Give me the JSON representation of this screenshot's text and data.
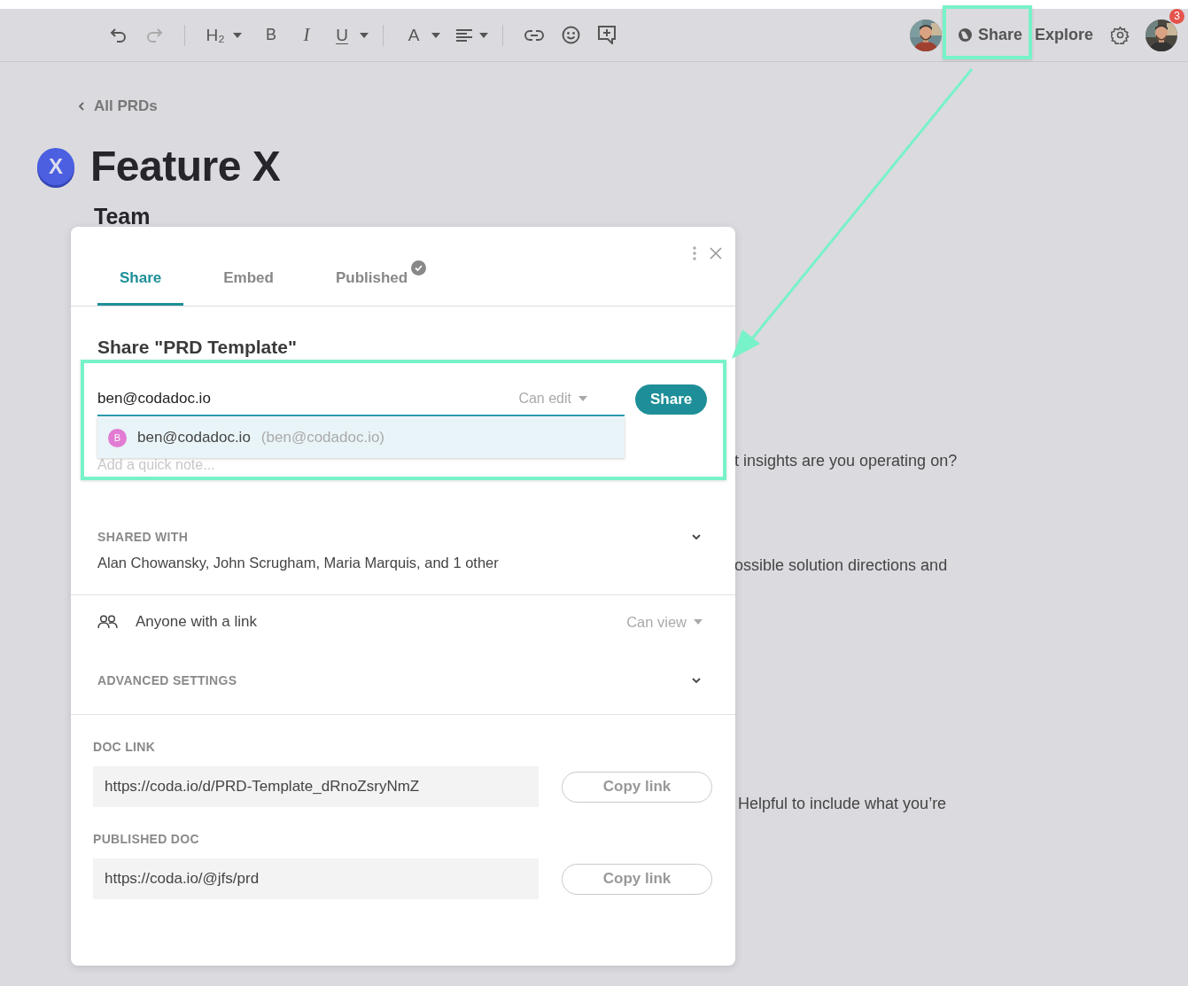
{
  "toolbar": {
    "undo": {
      "disabled": false
    },
    "redo": {
      "disabled": true
    },
    "heading_label": "H₂",
    "bold_label": "B",
    "italic_label": "I",
    "underline_label": "U",
    "color_label": "A"
  },
  "header": {
    "share_label": "Share",
    "explore_label": "Explore",
    "notification_count": "3"
  },
  "doc": {
    "back_label": "All PRDs",
    "badge_letter": "X",
    "title": "Feature X",
    "section_heading": "Team",
    "body_fragments": [
      "t insights are you operating on?",
      "ossible solution directions and",
      "Helpful to include what you’re"
    ]
  },
  "dialog": {
    "tabs": [
      {
        "label": "Share",
        "selected": true,
        "verified": false
      },
      {
        "label": "Embed",
        "selected": false,
        "verified": false
      },
      {
        "label": "Published",
        "selected": false,
        "verified": true
      }
    ],
    "heading": "Share \"PRD Template\"",
    "invite": {
      "value": "ben@codadoc.io",
      "permission": "Can edit",
      "button": "Share",
      "note_placeholder": "Add a quick note..."
    },
    "suggestion": {
      "initial": "B",
      "color": "#e27bd3",
      "name": "ben@codadoc.io",
      "email": "(ben@codadoc.io)"
    },
    "shared_with": {
      "label": "SHARED WITH",
      "people": "Alan Chowansky, John Scrugham, Maria Marquis, and 1 other",
      "expanded": false
    },
    "link_access": {
      "label": "Anyone with a link",
      "permission": "Can view"
    },
    "advanced": {
      "label": "ADVANCED SETTINGS",
      "expanded": false
    },
    "links": [
      {
        "label": "DOC LINK",
        "url": "https://coda.io/d/PRD-Template_dRnoZsryNmZ",
        "button": "Copy link"
      },
      {
        "label": "PUBLISHED DOC",
        "url": "https://coda.io/@jfs/prd",
        "button": "Copy link"
      }
    ]
  }
}
